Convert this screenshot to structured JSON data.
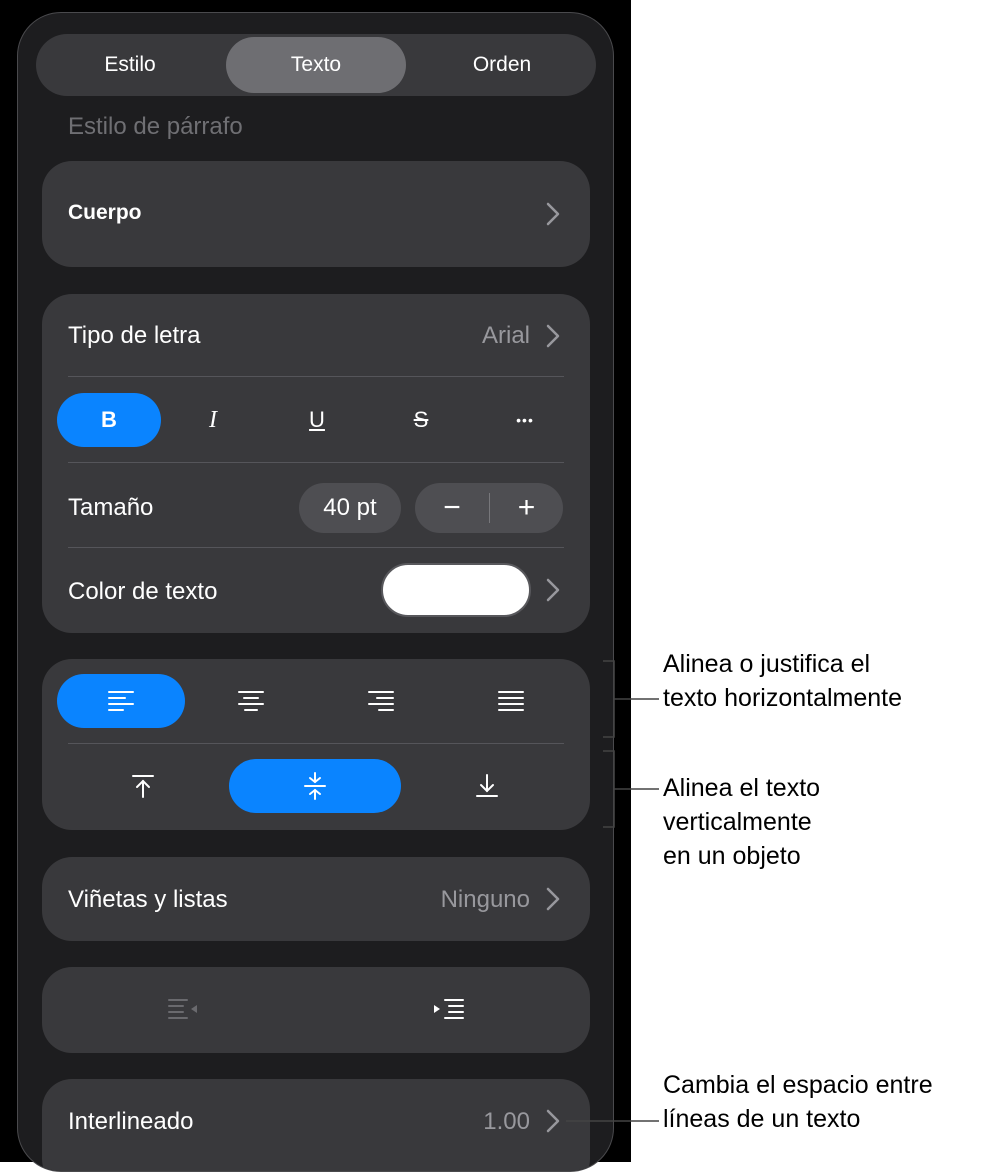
{
  "tabs": [
    "Estilo",
    "Texto",
    "Orden"
  ],
  "active_tab": "Texto",
  "section_label": "Estilo de párrafo",
  "paragraph_style": "Cuerpo",
  "font": {
    "label": "Tipo de letra",
    "value": "Arial"
  },
  "style_buttons": {
    "bold": "B",
    "italic": "I",
    "underline": "U",
    "strikethrough": "S",
    "more": "•••",
    "bold_active": true
  },
  "size": {
    "label": "Tamaño",
    "value": "40 pt",
    "decrement": "−",
    "increment": "+"
  },
  "text_color": {
    "label": "Color de texto",
    "value_color": "#ffffff"
  },
  "horizontal_alignment": {
    "options": [
      "left",
      "center",
      "right",
      "justify"
    ],
    "selected": "left"
  },
  "vertical_alignment": {
    "options": [
      "top",
      "middle",
      "bottom"
    ],
    "selected": "middle"
  },
  "bullets": {
    "label": "Viñetas y listas",
    "value": "Ninguno"
  },
  "indent": {
    "decrease_enabled": false,
    "increase_enabled": true
  },
  "line_spacing": {
    "label": "Interlineado",
    "value": "1.00"
  },
  "callouts": {
    "horizontal": [
      "Alinea o justifica el",
      "texto horizontalmente"
    ],
    "vertical": [
      "Alinea el texto",
      "verticalmente",
      "en un objeto"
    ],
    "spacing": [
      "Cambia el espacio entre",
      "líneas de un texto"
    ]
  },
  "colors": {
    "accent": "#0a84ff",
    "panel": "#1d1d1f",
    "card": "#39393c",
    "secondary_text": "#98989d"
  }
}
